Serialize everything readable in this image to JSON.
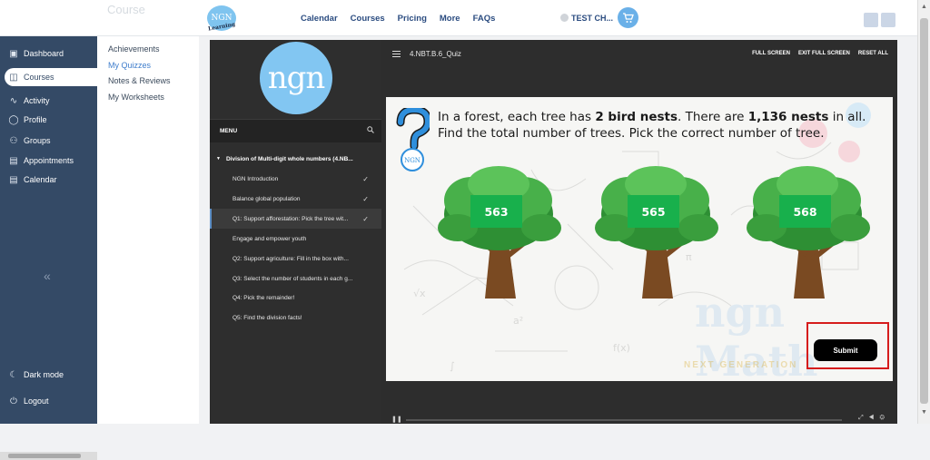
{
  "topbar": {
    "ghost_title": "Course",
    "logo": {
      "text": "NGN",
      "subtext": "Learning"
    },
    "nav": [
      "Calendar",
      "Courses",
      "Pricing",
      "More",
      "FAQs"
    ],
    "user": "TEST CH...",
    "cart_icon": "cart-icon"
  },
  "sidebar": {
    "items": [
      {
        "label": "Dashboard",
        "icon": "dashboard-icon"
      },
      {
        "label": "Courses",
        "icon": "book-icon",
        "active": true
      },
      {
        "label": "Activity",
        "icon": "activity-icon"
      },
      {
        "label": "Profile",
        "icon": "user-icon"
      },
      {
        "label": "Groups",
        "icon": "group-icon"
      },
      {
        "label": "Appointments",
        "icon": "calendar-icon"
      },
      {
        "label": "Calendar",
        "icon": "calendar-icon"
      }
    ],
    "bottom": [
      {
        "label": "Dark mode",
        "icon": "moon-icon"
      },
      {
        "label": "Logout",
        "icon": "power-icon"
      }
    ]
  },
  "subnav": {
    "items": [
      "Achievements",
      "My Quizzes",
      "Notes & Reviews",
      "My Worksheets"
    ],
    "selected": "My Quizzes"
  },
  "lesson_panel": {
    "brand": "ngn",
    "menu_label": "MENU",
    "section": "Division of Multi-digit whole numbers (4.NB...",
    "lessons": [
      {
        "label": "NGN Introduction",
        "done": true
      },
      {
        "label": "Balance global population",
        "done": true
      },
      {
        "label": "Q1: Support afforestation: Pick the tree wit...",
        "done": true,
        "current": true
      },
      {
        "label": "Engage and empower youth",
        "done": false
      },
      {
        "label": "Q2: Support agriculture: Fill in the box with...",
        "done": false
      },
      {
        "label": "Q3: Select the number of students in each g...",
        "done": false
      },
      {
        "label": "Q4: Pick the remainder!",
        "done": false
      },
      {
        "label": "Q5: Find the division facts!",
        "done": false
      }
    ]
  },
  "player": {
    "title": "4.NBT.B.6_Quiz",
    "buttons": [
      "FULL SCREEN",
      "EXIT FULL SCREEN",
      "RESET ALL"
    ],
    "question": {
      "part1": "In a forest, each tree has ",
      "bold1": "2 bird nests",
      "part2": ". There are ",
      "bold2": "1,136 nests",
      "part3": " in all. Find the total number of trees. Pick the correct number of tree."
    },
    "qmark_badge": "NGN",
    "options": [
      "563",
      "565",
      "568"
    ],
    "watermark": "ngn Math",
    "watermark_sub": "NEXT GENERATION",
    "submit_label": "Submit"
  }
}
